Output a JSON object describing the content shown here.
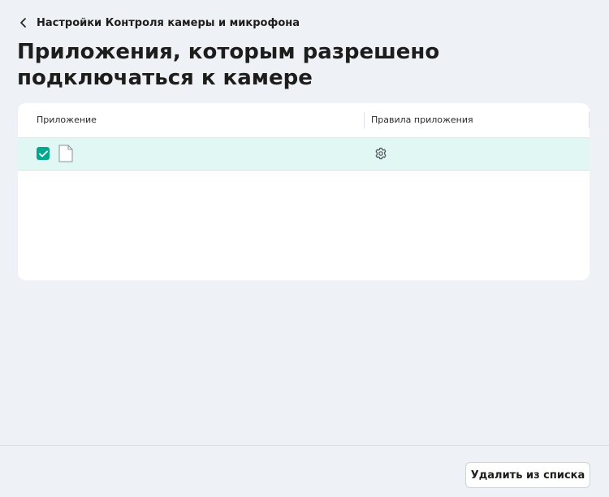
{
  "breadcrumb": {
    "label": "Настройки Контроля камеры и микрофона",
    "icon": "chevron-left-icon"
  },
  "page": {
    "title": "Приложения, которым разрешено подключаться к камере"
  },
  "table": {
    "columns": [
      "Приложение",
      "Правила приложения"
    ],
    "rows": [
      {
        "checked": true,
        "app_icon": "file-icon",
        "app_name": "",
        "rules_icon": "gear-icon"
      }
    ]
  },
  "footer": {
    "remove_label": "Удалить из списка"
  },
  "colors": {
    "background": "#eef1f6",
    "accent": "#00a88e",
    "selected_row": "#e0f7f3",
    "card": "#ffffff"
  }
}
